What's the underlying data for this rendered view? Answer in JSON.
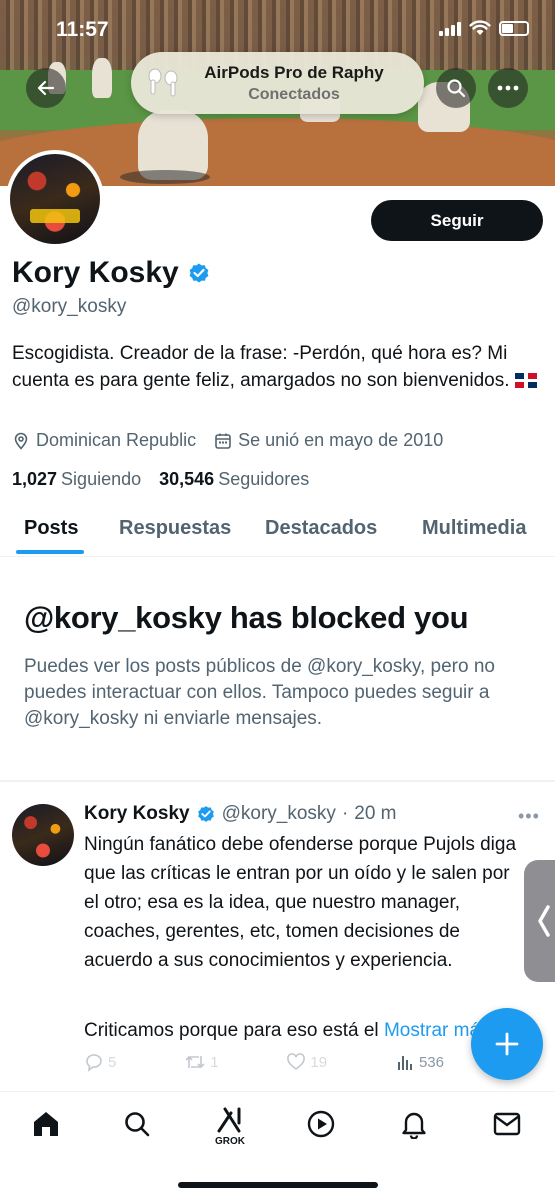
{
  "status_bar": {
    "time": "11:57"
  },
  "notification": {
    "device": "AirPods Pro de Raphy",
    "status": "Conectados"
  },
  "profile": {
    "follow_label": "Seguir",
    "display_name": "Kory Kosky",
    "handle": "@kory_kosky",
    "bio": "Escogidista. Creador de la frase: -Perdón, qué hora es? Mi cuenta es para gente feliz, amargados no son bienvenidos.",
    "location": "Dominican Republic",
    "joined": "Se unió en mayo de 2010",
    "following_count": "1,027",
    "following_label": "Siguiendo",
    "followers_count": "30,546",
    "followers_label": "Seguidores"
  },
  "tabs": [
    {
      "label": "Posts",
      "active": true
    },
    {
      "label": "Respuestas",
      "active": false
    },
    {
      "label": "Destacados",
      "active": false
    },
    {
      "label": "Multimedia",
      "active": false
    }
  ],
  "blocked": {
    "title": "@kory_kosky has blocked you",
    "description": "Puedes ver los posts públicos de @kory_kosky, pero no puedes interactuar con ellos. Tampoco puedes seguir a @kory_kosky ni enviarle mensajes."
  },
  "post": {
    "name": "Kory Kosky",
    "handle": "@kory_kosky",
    "separator": "·",
    "time": "20 m",
    "text": "Ningún fanático debe ofenderse porque Pujols diga que las críticas le entran por un oído y le salen por el otro; esa es la idea, que nuestro manager, coaches, gerentes, etc, tomen decisiones de acuerdo a sus conocimientos y experiencia.",
    "text2": "Criticamos porque para eso está el",
    "show_more": "Mostrar más",
    "replies": "5",
    "reposts": "1",
    "likes": "19",
    "views": "536"
  },
  "bottom_nav": {
    "grok_label": "GROK"
  },
  "colors": {
    "accent": "#1d9bf0",
    "text": "#0f1419",
    "secondary": "#536471"
  },
  "icons": [
    "back-arrow-icon",
    "search-icon",
    "more-icon",
    "airpods-icon",
    "verified-badge-icon",
    "location-icon",
    "calendar-icon",
    "reply-icon",
    "repost-icon",
    "like-icon",
    "views-icon",
    "compose-plus-icon",
    "home-icon",
    "grok-icon",
    "video-icon",
    "bell-icon",
    "mail-icon"
  ]
}
